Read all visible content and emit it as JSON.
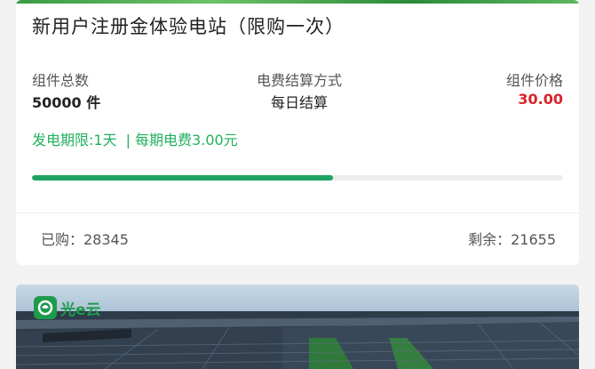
{
  "product": {
    "title": "新用户注册金体验电站（限购一次）",
    "total_components_label": "组件总数",
    "total_components_value": "50000 件",
    "billing_method_label": "电费结算方式",
    "billing_method_value": "每日结算",
    "component_price_label": "组件价格",
    "component_price_value": "30.00",
    "term_text": "发电期限:1天",
    "per_period_fee_text": "| 每期电费3.00元",
    "progress_fraction": 0.567,
    "purchased_text": "已购：28345",
    "remaining_text": "剩余：21655"
  },
  "banner": {
    "logo_text": "光e云"
  },
  "colors": {
    "accent_green": "#1fa463",
    "price_red": "#d9232b",
    "term_green": "#21b15e"
  }
}
